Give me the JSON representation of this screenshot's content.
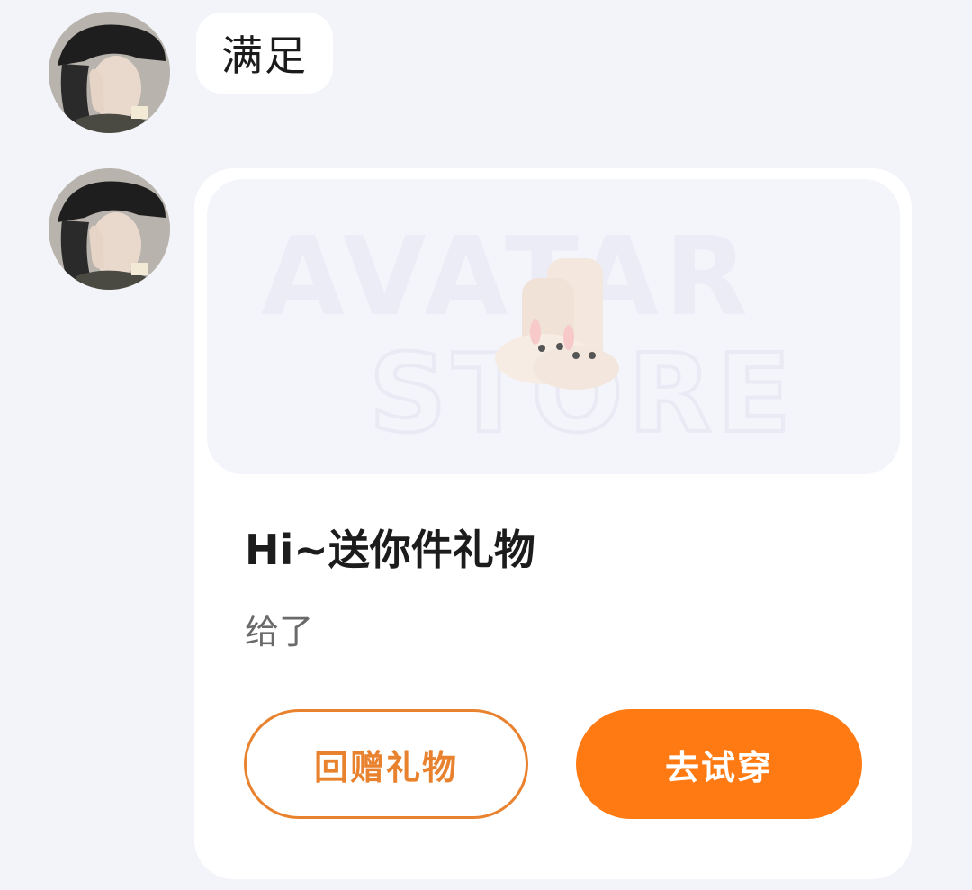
{
  "messages": [
    {
      "type": "text",
      "text": "满足"
    },
    {
      "type": "gift_card",
      "banner_watermark": [
        "AVATAR",
        "STORE"
      ],
      "title": "Hi~送你件礼物",
      "subtitle": "给了",
      "buttons": {
        "return_gift": "回赠礼物",
        "try_on": "去试穿"
      }
    }
  ],
  "colors": {
    "background": "#f3f4f9",
    "accent": "#ff7a13",
    "outline_accent": "#e9822f"
  }
}
